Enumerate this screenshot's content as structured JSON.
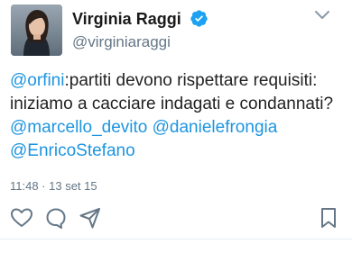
{
  "user": {
    "display_name": "Virginia Raggi",
    "handle": "@virginiaraggi",
    "verified": true,
    "avatar_icon": "profile-photo",
    "verified_color": "#1da1f2"
  },
  "tweet": {
    "segments": [
      {
        "text": "@orfini",
        "mention": true
      },
      {
        "text": ":partiti devono rispettare requisiti: iniziamo a cacciare indagati e condannati?",
        "mention": false
      },
      {
        "text": "@marcello_devito",
        "mention": true
      },
      {
        "text": " ",
        "mention": false
      },
      {
        "text": "@danielefrongia",
        "mention": true
      },
      {
        "text": " ",
        "mention": false
      },
      {
        "text": "@EnricoStefano",
        "mention": true
      }
    ],
    "timestamp": "11:48 · 13 set 15"
  },
  "actions": {
    "like_icon": "heart-icon",
    "reply_icon": "reply-icon",
    "share_icon": "share-icon",
    "bookmark_icon": "bookmark-icon"
  },
  "colors": {
    "mention": "#1d95e0",
    "muted": "#657786",
    "icon": "#657786"
  }
}
